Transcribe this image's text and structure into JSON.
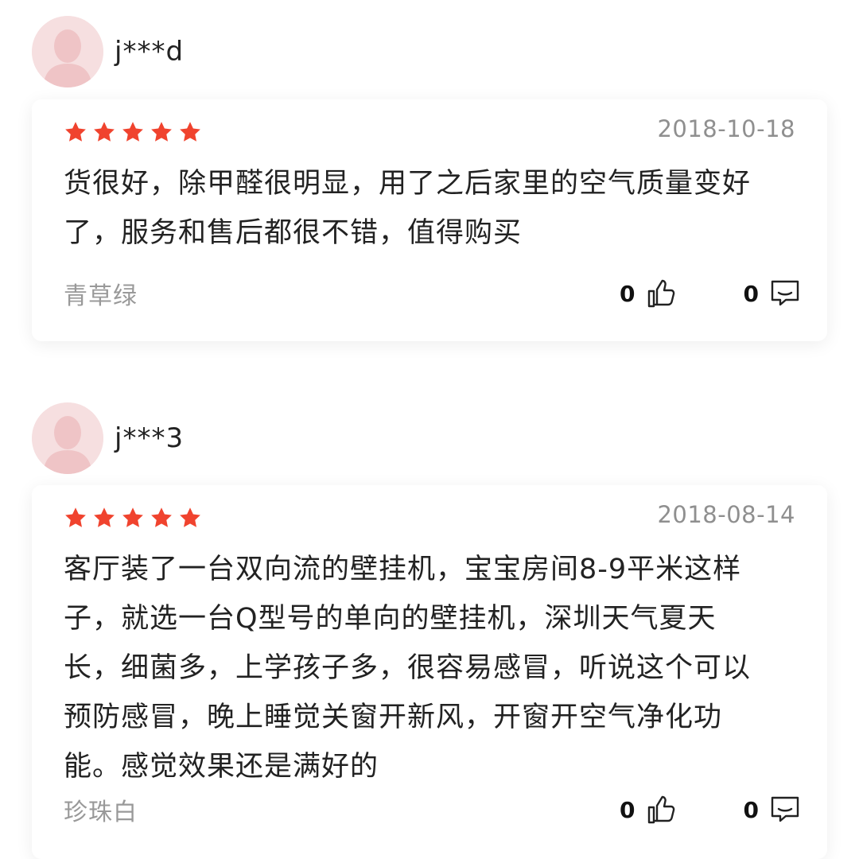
{
  "reviews": [
    {
      "username": "j***d",
      "rating": 5,
      "date": "2018-10-18",
      "content_lines": [
        "货很好，除甲醛很明显，用了之后家里的空气质量变好",
        "了，服务和售后都很不错，值得购买"
      ],
      "color_variant": "青草绿",
      "likes": "0",
      "comments": "0"
    },
    {
      "username": "j***3",
      "rating": 5,
      "date": "2018-08-14",
      "content_lines": [
        "客厅装了一台双向流的壁挂机，宝宝房间8-9平米这样",
        "子，就选一台Q型号的单向的壁挂机，深圳天气夏天",
        "长，细菌多，上学孩子多，很容易感冒，听说这个可以",
        "预防感冒，晚上睡觉关窗开新风，开窗开空气净化功",
        "能。感觉效果还是满好的"
      ],
      "color_variant": "珍珠白",
      "likes": "0",
      "comments": "0"
    }
  ],
  "icons": {
    "star": "star-icon",
    "like": "thumbs-up-icon",
    "comment": "comment-icon",
    "avatar": "default-avatar-icon"
  },
  "colors": {
    "star_fill": "#f0432e",
    "date_text": "#8f8f8f",
    "muted_text": "#999999",
    "avatar_bg": "#f6dfe0"
  }
}
